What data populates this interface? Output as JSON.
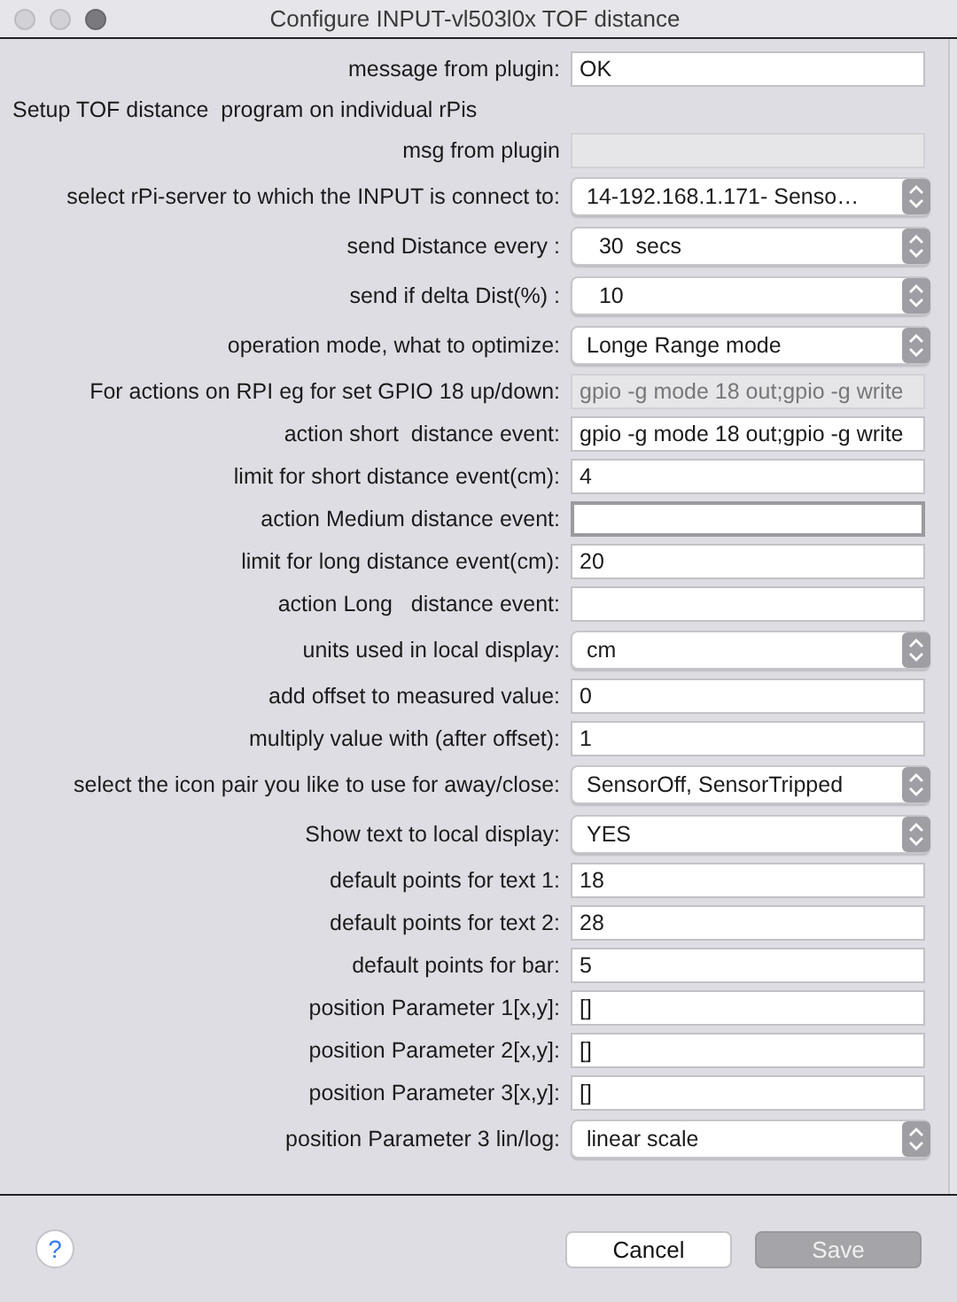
{
  "window": {
    "title": "Configure INPUT-vl503l0x TOF distance"
  },
  "rows": [
    {
      "kind": "text",
      "label": "message from plugin:",
      "value": "OK",
      "disabled": false,
      "focused": false
    },
    {
      "kind": "note",
      "label": "Setup TOF distance  program on individual rPis"
    },
    {
      "kind": "text",
      "label": "msg from plugin",
      "disabled": true,
      "focused": false
    },
    {
      "kind": "select",
      "label": "select rPi-server to which the INPUT is connect to:",
      "value": "14-192.168.1.171- Senso…"
    },
    {
      "kind": "select",
      "label": "send Distance every :",
      "value": "  30  secs"
    },
    {
      "kind": "select",
      "label": "send if delta Dist(%) :",
      "value": "  10"
    },
    {
      "kind": "select",
      "label": "operation mode, what to optimize:",
      "value": "Longe Range mode"
    },
    {
      "kind": "text",
      "label": "For actions on RPI eg for set GPIO 18 up/down:",
      "value": "gpio -g mode 18 out;gpio -g write",
      "disabled": true,
      "focused": false
    },
    {
      "kind": "text",
      "label": "action short  distance event:",
      "value": "gpio -g mode 18 out;gpio -g write",
      "disabled": false,
      "focused": false
    },
    {
      "kind": "text",
      "label": "limit for short distance event(cm):",
      "value": "4",
      "disabled": false,
      "focused": false
    },
    {
      "kind": "text",
      "label": "action Medium distance event:",
      "disabled": false,
      "focused": true
    },
    {
      "kind": "text",
      "label": "limit for long distance event(cm):",
      "value": "20",
      "disabled": false,
      "focused": false
    },
    {
      "kind": "text",
      "label": "action Long   distance event:",
      "disabled": false,
      "focused": false
    },
    {
      "kind": "select",
      "label": "units used in local display:",
      "value": "cm"
    },
    {
      "kind": "text",
      "label": "add offset to measured value:",
      "value": "0",
      "disabled": false,
      "focused": false
    },
    {
      "kind": "text",
      "label": "multiply value with (after offset):",
      "value": "1",
      "disabled": false,
      "focused": false
    },
    {
      "kind": "select",
      "label": "select the icon pair you like to use for away/close:",
      "value": "SensorOff, SensorTripped"
    },
    {
      "kind": "select",
      "label": "Show text to local display:",
      "value": "YES"
    },
    {
      "kind": "text",
      "label": "default points for text 1:",
      "value": "18",
      "disabled": false,
      "focused": false
    },
    {
      "kind": "text",
      "label": "default points for text 2:",
      "value": "28",
      "disabled": false,
      "focused": false
    },
    {
      "kind": "text",
      "label": "default points for bar:",
      "value": "5",
      "disabled": false,
      "focused": false
    },
    {
      "kind": "text",
      "label": "position Parameter 1[x,y]:",
      "value": "[]",
      "disabled": false,
      "focused": false
    },
    {
      "kind": "text",
      "label": "position Parameter 2[x,y]:",
      "value": "[]",
      "disabled": false,
      "focused": false
    },
    {
      "kind": "text",
      "label": "position Parameter 3[x,y]:",
      "value": "[]",
      "disabled": false,
      "focused": false
    },
    {
      "kind": "select",
      "label": "position Parameter 3 lin/log:",
      "value": "linear scale"
    }
  ],
  "footer": {
    "help": "?",
    "buttons": [
      {
        "label": "Cancel",
        "disabled": false
      },
      {
        "label": "Save",
        "disabled": true
      }
    ]
  }
}
